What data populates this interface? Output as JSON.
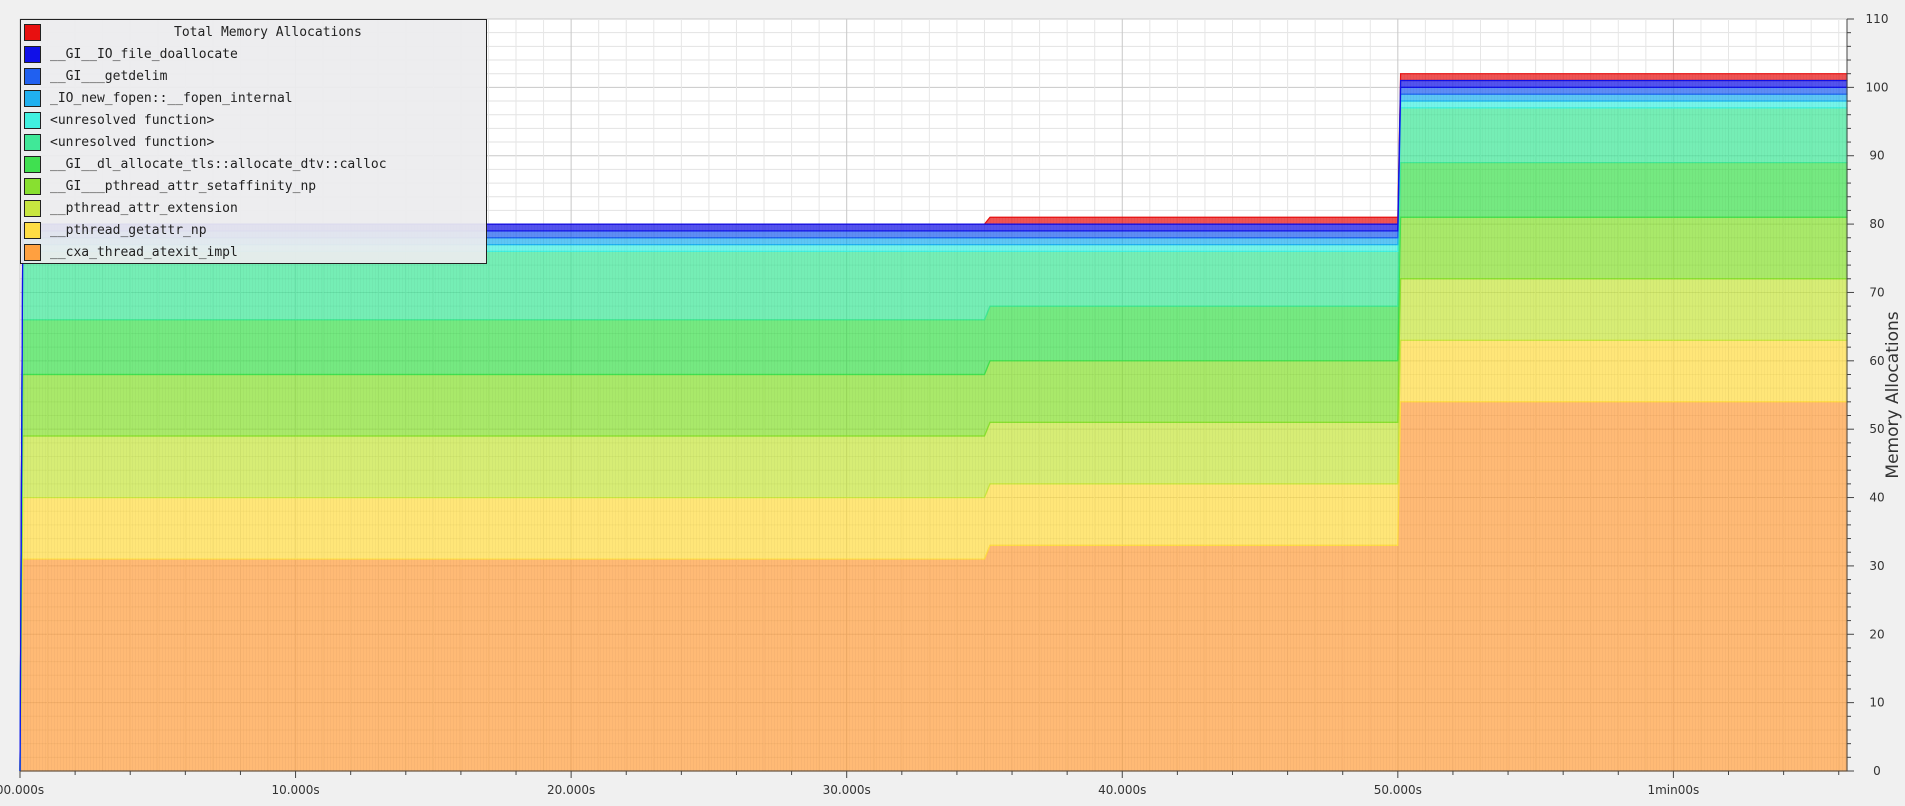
{
  "chart_data": {
    "type": "area",
    "stacked": true,
    "xlabel": "",
    "ylabel": "Memory Allocations",
    "xlim": [
      0,
      66.3
    ],
    "ylim": [
      0,
      110
    ],
    "x_ticks": [
      {
        "value": 0,
        "label": "00.000s"
      },
      {
        "value": 10,
        "label": "10.000s"
      },
      {
        "value": 20,
        "label": "20.000s"
      },
      {
        "value": 30,
        "label": "30.000s"
      },
      {
        "value": 40,
        "label": "40.000s"
      },
      {
        "value": 50,
        "label": "50.000s"
      },
      {
        "value": 60,
        "label": "1min00s"
      }
    ],
    "y_ticks": [
      0,
      10,
      20,
      30,
      40,
      50,
      60,
      70,
      80,
      90,
      100,
      110
    ],
    "grid": true,
    "legend_position": "top-left",
    "x": [
      0,
      0.1,
      35.0,
      35.2,
      50.0,
      50.1,
      66.3
    ],
    "series": [
      {
        "name": "__cxa_thread_atexit_impl",
        "color": "#ffa040",
        "values": [
          0,
          31,
          31,
          33,
          33,
          54,
          54
        ]
      },
      {
        "name": "__pthread_getattr_np",
        "color": "#ffdd44",
        "values": [
          0,
          9,
          9,
          9,
          9,
          9,
          9
        ]
      },
      {
        "name": "__pthread_attr_extension",
        "color": "#c8e640",
        "values": [
          0,
          9,
          9,
          9,
          9,
          9,
          9
        ]
      },
      {
        "name": "__GI___pthread_attr_setaffinity_np",
        "color": "#88e030",
        "values": [
          0,
          9,
          9,
          9,
          9,
          9,
          9
        ]
      },
      {
        "name": "__GI__dl_allocate_tls::allocate_dtv::calloc",
        "color": "#40e050",
        "values": [
          0,
          8,
          8,
          8,
          8,
          8,
          8
        ]
      },
      {
        "name": "<unresolved function>",
        "color": "#40e898",
        "values": [
          0,
          10,
          10,
          8,
          8,
          8,
          8
        ]
      },
      {
        "name": "<unresolved function>",
        "color": "#40f0e0",
        "values": [
          0,
          1,
          1,
          1,
          1,
          1,
          1
        ]
      },
      {
        "name": "_IO_new_fopen::__fopen_internal",
        "color": "#20b0f0",
        "values": [
          0,
          1,
          1,
          1,
          1,
          1,
          1
        ]
      },
      {
        "name": "__GI___getdelim",
        "color": "#2060f0",
        "values": [
          0,
          1,
          1,
          1,
          1,
          1,
          1
        ]
      },
      {
        "name": "__GI__IO_file_doallocate",
        "color": "#1010e8",
        "values": [
          0,
          1,
          1,
          1,
          1,
          1,
          1
        ]
      }
    ],
    "total": {
      "name": "Total Memory Allocations",
      "color": "#e81010",
      "values": [
        0,
        79,
        79,
        81,
        81,
        102,
        102
      ]
    }
  },
  "legend": {
    "title": "Total Memory Allocations",
    "title_color": "#e81010",
    "items": [
      {
        "label": "__GI__IO_file_doallocate",
        "color": "#1010e8"
      },
      {
        "label": "__GI___getdelim",
        "color": "#2060f0"
      },
      {
        "label": "_IO_new_fopen::__fopen_internal",
        "color": "#20b0f0"
      },
      {
        "label": "<unresolved function>",
        "color": "#40f0e0"
      },
      {
        "label": "<unresolved function>",
        "color": "#40e898"
      },
      {
        "label": "__GI__dl_allocate_tls::allocate_dtv::calloc",
        "color": "#40e050"
      },
      {
        "label": "__GI___pthread_attr_setaffinity_np",
        "color": "#88e030"
      },
      {
        "label": "__pthread_attr_extension",
        "color": "#c8e640"
      },
      {
        "label": "__pthread_getattr_np",
        "color": "#ffdd44"
      },
      {
        "label": "__cxa_thread_atexit_impl",
        "color": "#ffa040"
      }
    ]
  }
}
